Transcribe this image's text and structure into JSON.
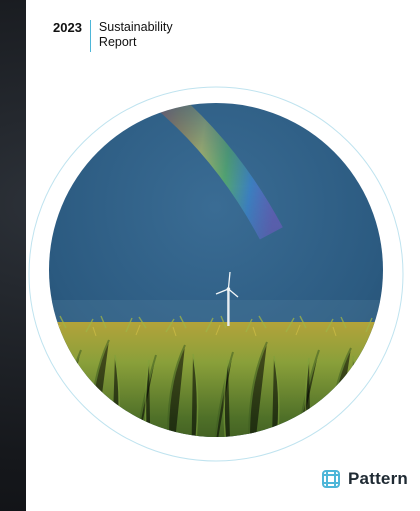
{
  "report": {
    "year": "2023",
    "title_line1": "Sustainability",
    "title_line2": "Report"
  },
  "brand": {
    "name": "Pattern",
    "accent_color": "#4db6d8",
    "logo_icon": "pattern-grid-logo-icon"
  },
  "cover_image": {
    "subject": "wind-turbine-cornfield-rainbow",
    "sky_color": "#2b5a80",
    "field_color": "#5d7a2c"
  }
}
